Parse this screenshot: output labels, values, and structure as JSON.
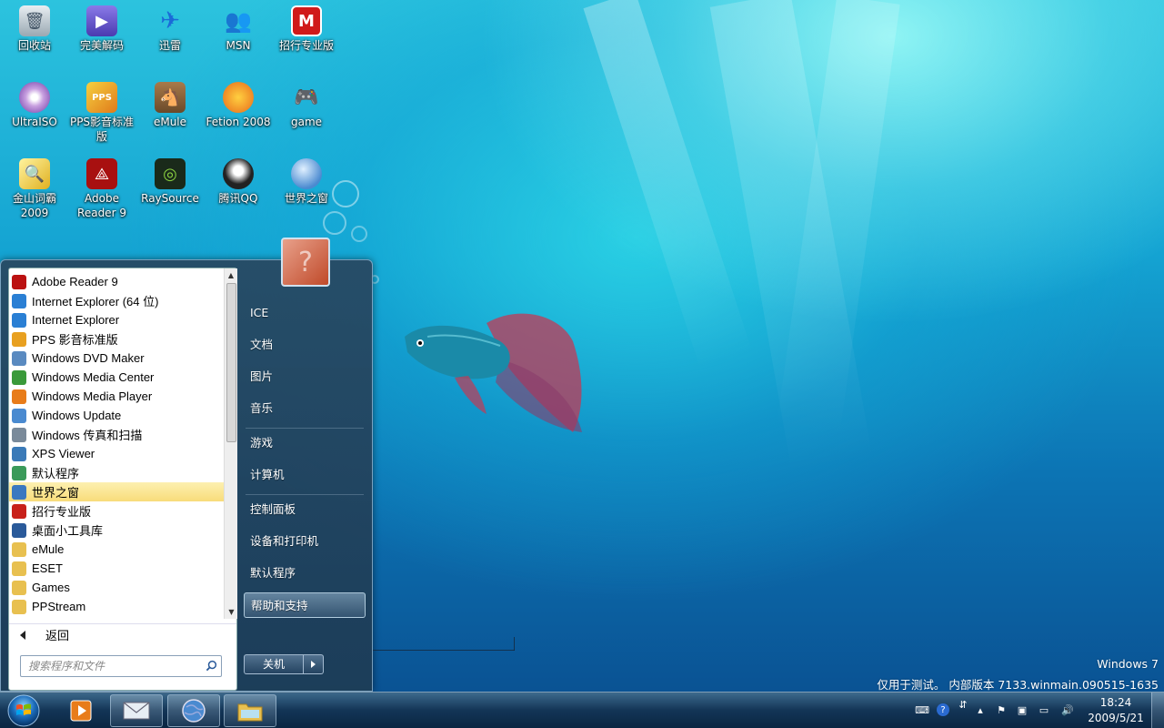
{
  "desktop": {
    "icons": [
      {
        "label": "回收站",
        "icon": "recycle-bin-icon"
      },
      {
        "label": "完美解码",
        "icon": "video-player-icon"
      },
      {
        "label": "迅雷",
        "icon": "thunder-icon"
      },
      {
        "label": "MSN",
        "icon": "msn-icon"
      },
      {
        "label": "招行专业版",
        "icon": "cmb-icon"
      },
      {
        "label": "UltraISO",
        "icon": "disc-icon"
      },
      {
        "label": "PPS影音标准版",
        "icon": "pps-icon"
      },
      {
        "label": "eMule",
        "icon": "emule-icon"
      },
      {
        "label": "Fetion 2008",
        "icon": "fetion-icon"
      },
      {
        "label": "game",
        "icon": "gamepad-icon"
      },
      {
        "label": "金山词霸2009",
        "icon": "dictionary-icon"
      },
      {
        "label": "Adobe Reader 9",
        "icon": "adobe-reader-icon"
      },
      {
        "label": "RaySource",
        "icon": "raysource-icon"
      },
      {
        "label": "腾讯QQ",
        "icon": "qq-icon"
      },
      {
        "label": "世界之窗",
        "icon": "globe-icon"
      }
    ]
  },
  "start_menu": {
    "programs": [
      {
        "label": "Adobe Reader 9",
        "icon": "adobe-reader-icon",
        "color": "#b11"
      },
      {
        "label": "Internet Explorer (64 位)",
        "icon": "ie-icon",
        "color": "#2a7fd4"
      },
      {
        "label": "Internet Explorer",
        "icon": "ie-icon",
        "color": "#2a7fd4"
      },
      {
        "label": "PPS 影音标准版",
        "icon": "pps-icon",
        "color": "#e8a020"
      },
      {
        "label": "Windows DVD Maker",
        "icon": "dvd-maker-icon",
        "color": "#5a8ac0"
      },
      {
        "label": "Windows Media Center",
        "icon": "media-center-icon",
        "color": "#3a9a3a"
      },
      {
        "label": "Windows Media Player",
        "icon": "media-player-icon",
        "color": "#e87c1a"
      },
      {
        "label": "Windows Update",
        "icon": "windows-update-icon",
        "color": "#4a8ad0"
      },
      {
        "label": "Windows 传真和扫描",
        "icon": "fax-scan-icon",
        "color": "#7a8a9a"
      },
      {
        "label": "XPS Viewer",
        "icon": "xps-viewer-icon",
        "color": "#3a7ab8"
      },
      {
        "label": "默认程序",
        "icon": "default-programs-icon",
        "color": "#3a9a5a"
      },
      {
        "label": "世界之窗",
        "icon": "globe-icon",
        "color": "#3a78c0",
        "selected": true
      },
      {
        "label": "招行专业版",
        "icon": "cmb-icon",
        "color": "#c8201a"
      },
      {
        "label": "桌面小工具库",
        "icon": "gadgets-icon",
        "color": "#2a5a9a"
      },
      {
        "label": "eMule",
        "icon": "folder-icon",
        "color": "#e8c050"
      },
      {
        "label": "ESET",
        "icon": "folder-icon",
        "color": "#e8c050"
      },
      {
        "label": "Games",
        "icon": "folder-icon",
        "color": "#e8c050"
      },
      {
        "label": "PPStream",
        "icon": "folder-icon",
        "color": "#e8c050"
      }
    ],
    "back_label": "返回",
    "search_placeholder": "搜索程序和文件",
    "right_items": {
      "user": "ICE",
      "documents": "文档",
      "pictures": "图片",
      "music": "音乐",
      "games": "游戏",
      "computer": "计算机",
      "control_panel": "控制面板",
      "devices_printers": "设备和打印机",
      "default_programs": "默认程序",
      "help_support": "帮助和支持"
    },
    "shutdown_label": "关机"
  },
  "watermark": {
    "line1": "Windows 7",
    "line2": "仅用于测试。 内部版本 7133.winmain.090515-1635"
  },
  "taskbar": {
    "time": "18:24",
    "date": "2009/5/21"
  }
}
